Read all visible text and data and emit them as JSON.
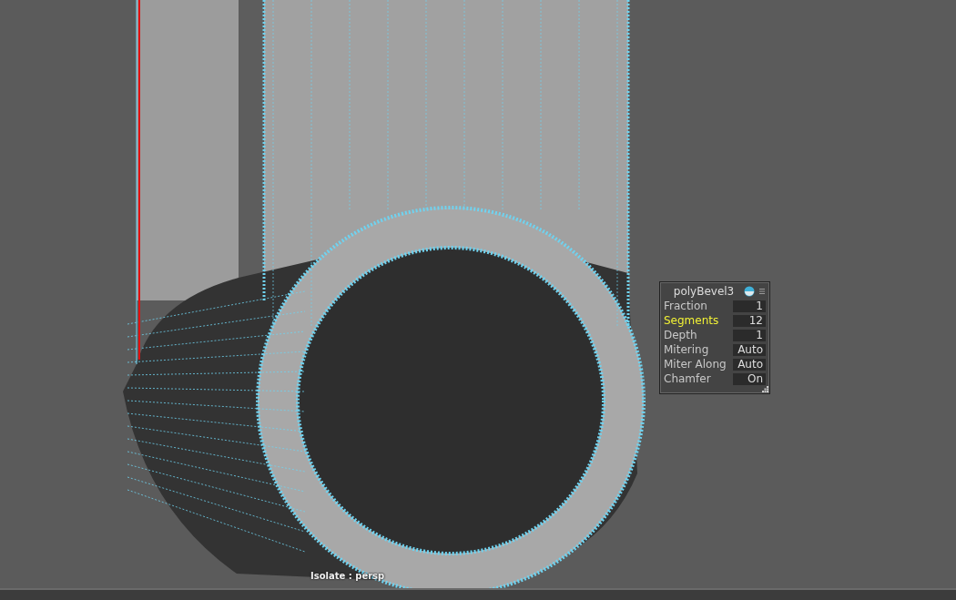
{
  "viewport": {
    "camera_label": "Isolate : persp"
  },
  "attribute_panel": {
    "title": "polyBevel3",
    "rows": [
      {
        "label": "Fraction",
        "value": "1",
        "selected": false
      },
      {
        "label": "Segments",
        "value": "12",
        "selected": true
      },
      {
        "label": "Depth",
        "value": "1",
        "selected": false
      },
      {
        "label": "Mitering",
        "value": "Auto",
        "selected": false
      },
      {
        "label": "Miter Along",
        "value": "Auto",
        "selected": false
      },
      {
        "label": "Chamfer",
        "value": "On",
        "selected": false
      }
    ]
  }
}
